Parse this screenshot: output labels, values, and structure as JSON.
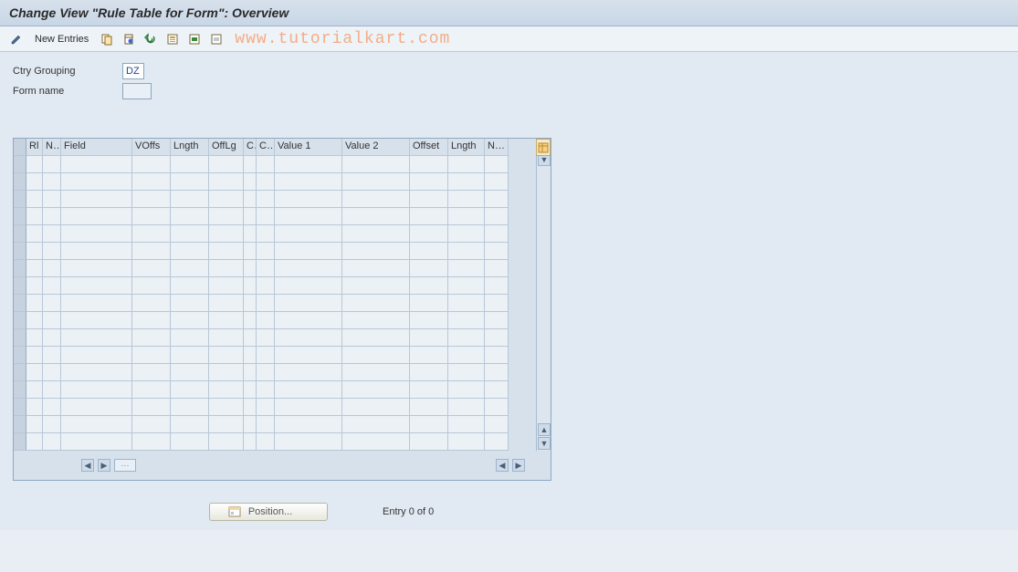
{
  "title": "Change View \"Rule Table for Form\": Overview",
  "toolbar": {
    "new_entries": "New Entries"
  },
  "watermark": "www.tutorialkart.com",
  "fields": {
    "ctry_grouping_label": "Ctry Grouping",
    "ctry_grouping_value": "DZ",
    "form_name_label": "Form name",
    "form_name_value": ""
  },
  "columns": {
    "rl": "Rl",
    "n": "N..",
    "field": "Field",
    "voffs": "VOffs",
    "lngth": "Lngth",
    "offlg": "OffLg",
    "c1": "C",
    "c2": "C..",
    "value1": "Value 1",
    "value2": "Value 2",
    "offset": "Offset",
    "lngth2": "Lngth",
    "nev": "Nev"
  },
  "footer": {
    "position": "Position...",
    "entry": "Entry 0 of 0"
  }
}
